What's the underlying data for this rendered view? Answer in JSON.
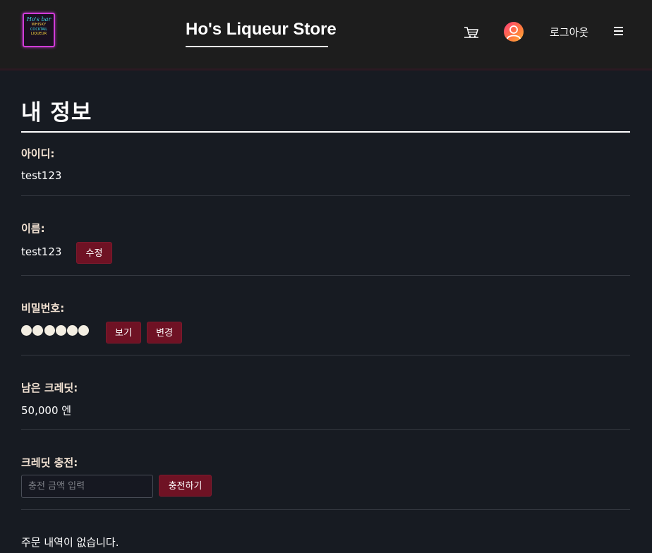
{
  "header": {
    "logo": {
      "line1": "Ho's bar",
      "line2": "WHISKY",
      "line3": "COCKTAIL",
      "line4": "LIQUEUR"
    },
    "brand": "Ho's Liqueur Store",
    "icons": {
      "cart": "cart-icon",
      "profile": "avatar-icon",
      "menu": "hamburger-menu-icon"
    },
    "logout_label": "로그아웃"
  },
  "main": {
    "title": "내 정보",
    "id_section": {
      "label": "아이디:",
      "value": "test123"
    },
    "name_section": {
      "label": "이름:",
      "value": "test123",
      "edit_label": "수정"
    },
    "password_section": {
      "label": "비밀번호:",
      "masked_count": 6,
      "show_label": "보기",
      "change_label": "변경"
    },
    "credit_section": {
      "label": "남은 크레딧:",
      "value": "50,000 엔"
    },
    "charge_section": {
      "label": "크레딧 충전:",
      "placeholder": "충전 금액 입력",
      "value": "",
      "button_label": "충전하기"
    },
    "orders_message": "주문 내역이 없습니다."
  },
  "colors": {
    "background": "#171b22",
    "header": "#1d1d1d",
    "accent_button": "#6f1224",
    "label": "#f3e3d3"
  }
}
